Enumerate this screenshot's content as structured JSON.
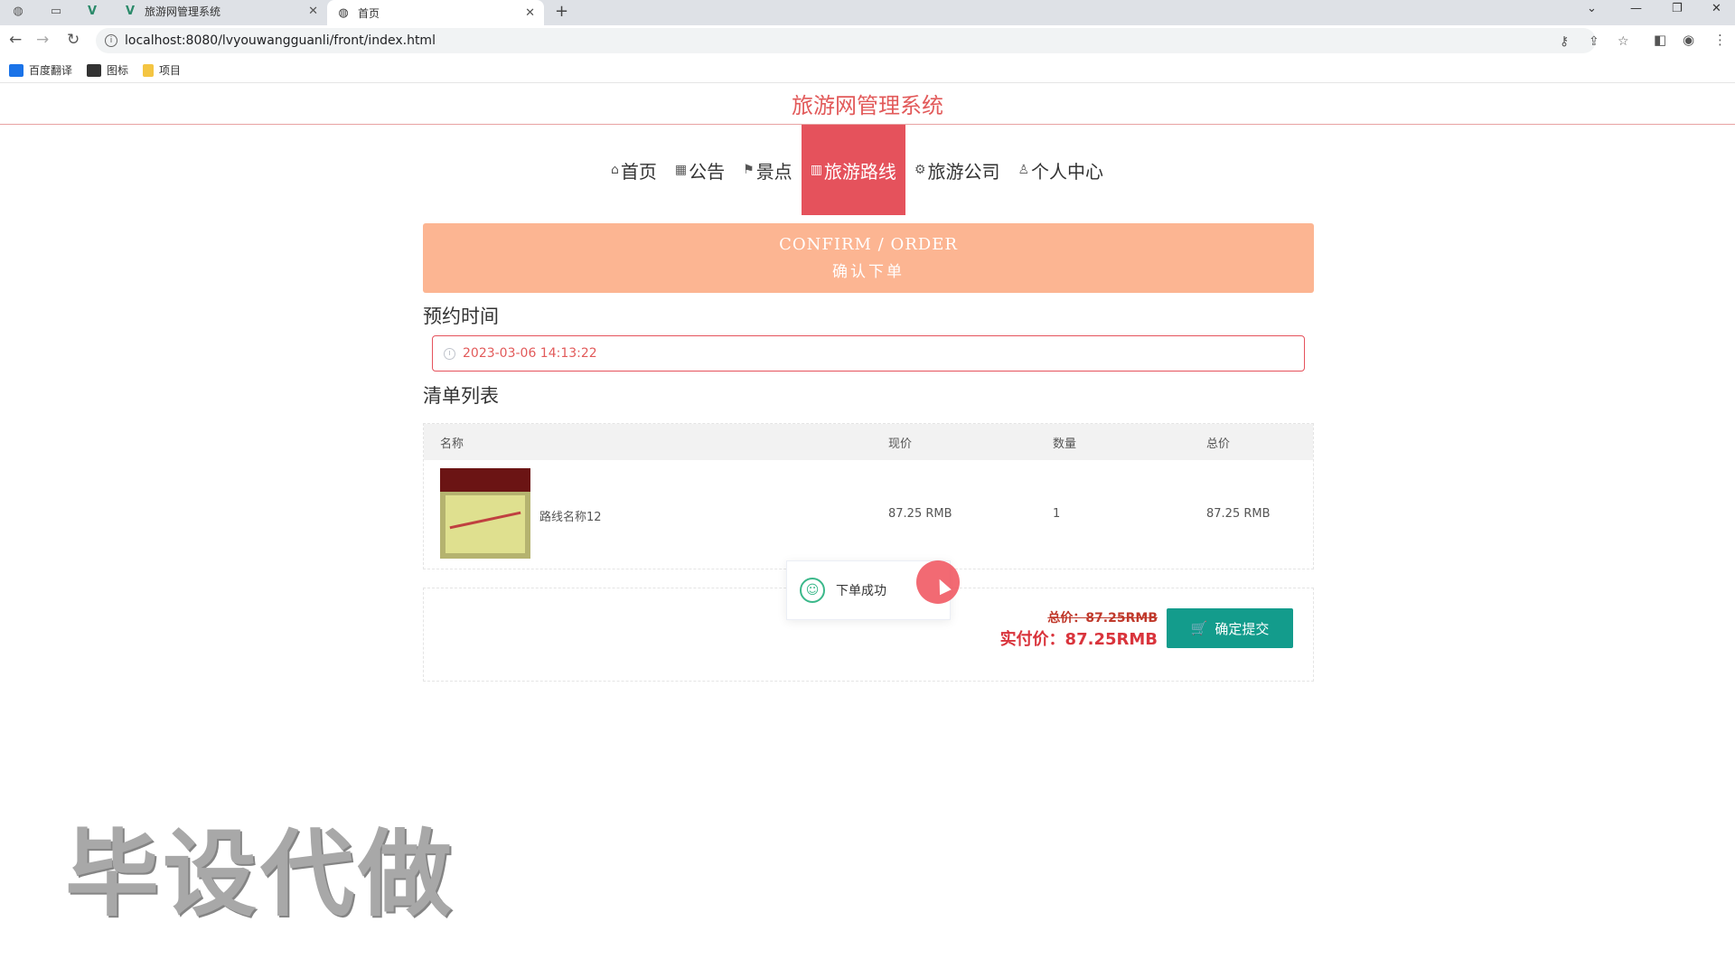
{
  "browser": {
    "tabs": [
      {
        "title": "旅游网管理系统",
        "active": false
      },
      {
        "title": "首页",
        "active": true
      }
    ],
    "url": "localhost:8080/lvyouwangguanli/front/index.html",
    "bookmarks": [
      {
        "label": "百度翻译",
        "icon": "translate-icon",
        "color": "#1a73e8"
      },
      {
        "label": "图标",
        "icon": "image-icon",
        "color": "#333333"
      },
      {
        "label": "项目",
        "icon": "folder-icon",
        "color": "#f4c542"
      }
    ]
  },
  "site": {
    "title": "旅游网管理系统",
    "nav": [
      {
        "label": "首页",
        "icon": "home-icon",
        "glyph": "⌂",
        "active": false
      },
      {
        "label": "公告",
        "icon": "announcement-icon",
        "glyph": "▦",
        "active": false
      },
      {
        "label": "景点",
        "icon": "flag-icon",
        "glyph": "⚑",
        "active": false
      },
      {
        "label": "旅游路线",
        "icon": "route-icon",
        "glyph": "▥",
        "active": true
      },
      {
        "label": "旅游公司",
        "icon": "gear-icon",
        "glyph": "⚙",
        "active": false
      },
      {
        "label": "个人中心",
        "icon": "user-icon",
        "glyph": "♙",
        "active": false
      }
    ]
  },
  "banner": {
    "en": "CONFIRM / ORDER",
    "cn": "确认下单"
  },
  "booking": {
    "label": "预约时间",
    "value": "2023-03-06 14:13:22"
  },
  "cart": {
    "title": "清单列表",
    "columns": [
      "名称",
      "现价",
      "数量",
      "总价"
    ],
    "rows": [
      {
        "name": "路线名称12",
        "price": "87.25 RMB",
        "qty": "1",
        "total": "87.25 RMB"
      }
    ]
  },
  "summary": {
    "total_label": "总价：87.25RMB",
    "real_label": "实付价：87.25RMB",
    "submit_label": "确定提交"
  },
  "toast": {
    "message": "下单成功"
  },
  "watermark": "毕设代做",
  "colors": {
    "accent": "#e5525c",
    "banner": "#fcb592",
    "submit": "#139c8c"
  }
}
